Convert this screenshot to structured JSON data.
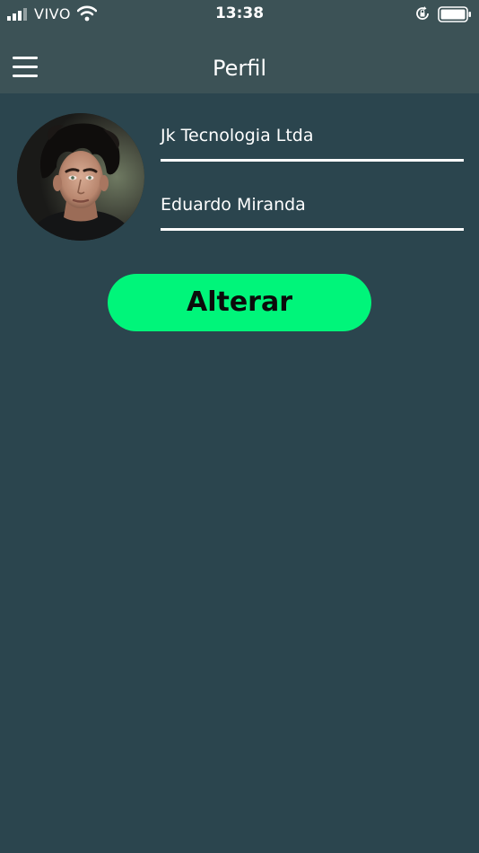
{
  "status_bar": {
    "carrier": "VIVO",
    "time": "13:38"
  },
  "nav": {
    "title": "Perfil",
    "menu_icon": "hamburger-menu-icon"
  },
  "profile": {
    "company_value": "Jk Tecnologia Ltda",
    "name_value": "Eduardo Miranda"
  },
  "actions": {
    "save_label": "Alterar"
  },
  "colors": {
    "background": "#2b454e",
    "header": "#3c5256",
    "accent_button": "#00f57a",
    "text": "#ffffff"
  }
}
